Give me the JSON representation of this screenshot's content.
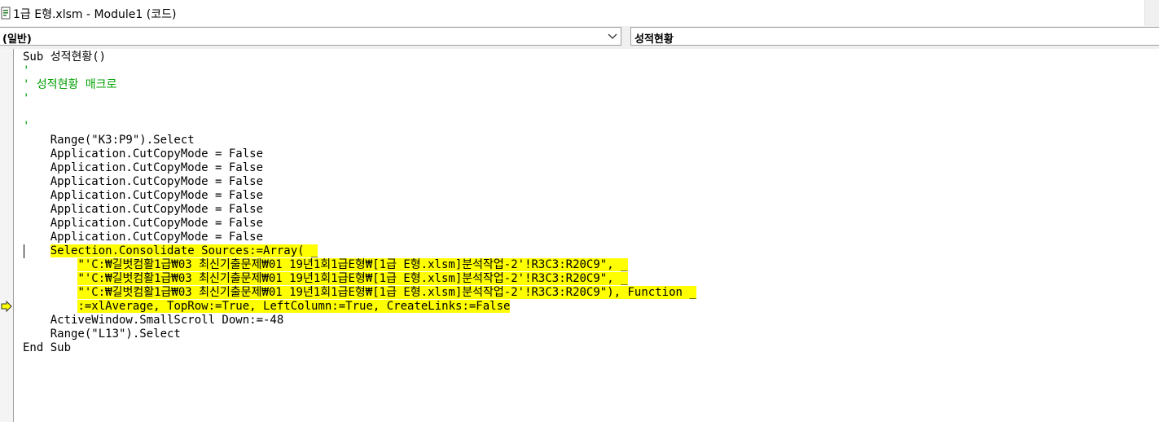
{
  "window": {
    "title": "1급 E형.xlsm - Module1 (코드)"
  },
  "dropdowns": {
    "object_value": "(일반)",
    "procedure_value": "성적현황"
  },
  "code": {
    "lines": [
      {
        "text": "Sub 성적현황()",
        "kind": "code"
      },
      {
        "text": "'",
        "kind": "comment"
      },
      {
        "text": "' 성적현황 매크로",
        "kind": "comment"
      },
      {
        "text": "'",
        "kind": "comment"
      },
      {
        "text": "",
        "kind": "code"
      },
      {
        "text": "'",
        "kind": "comment"
      },
      {
        "text": "    Range(\"K3:P9\").Select",
        "kind": "code"
      },
      {
        "text": "    Application.CutCopyMode = False",
        "kind": "code"
      },
      {
        "text": "    Application.CutCopyMode = False",
        "kind": "code"
      },
      {
        "text": "    Application.CutCopyMode = False",
        "kind": "code"
      },
      {
        "text": "    Application.CutCopyMode = False",
        "kind": "code"
      },
      {
        "text": "    Application.CutCopyMode = False",
        "kind": "code"
      },
      {
        "text": "    Application.CutCopyMode = False",
        "kind": "code"
      },
      {
        "text": "    Application.CutCopyMode = False",
        "kind": "code"
      },
      {
        "text": "    ",
        "hl": "Selection.Consolidate Sources:=Array( _",
        "kind": "highlight"
      },
      {
        "text": "        ",
        "hl": "\"'C:₩길벗컴활1급₩03 최신기출문제₩01 19년1회1급E형₩[1급 E형.xlsm]분석작업-2'!R3C3:R20C9\", _",
        "kind": "highlight"
      },
      {
        "text": "        ",
        "hl": "\"'C:₩길벗컴활1급₩03 최신기출문제₩01 19년1회1급E형₩[1급 E형.xlsm]분석작업-2'!R3C3:R20C9\", _",
        "kind": "highlight"
      },
      {
        "text": "        ",
        "hl": "\"'C:₩길벗컴활1급₩03 최신기출문제₩01 19년1회1급E형₩[1급 E형.xlsm]분석작업-2'!R3C3:R20C9\"), Function _",
        "kind": "highlight"
      },
      {
        "text": "        ",
        "hl": ":=xlAverage, TopRow:=True, LeftColumn:=True, CreateLinks:=False",
        "kind": "highlight"
      },
      {
        "text": "    ActiveWindow.SmallScroll Down:=-48",
        "kind": "code"
      },
      {
        "text": "    Range(\"L13\").Select",
        "kind": "code"
      },
      {
        "text": "End Sub",
        "kind": "code"
      }
    ]
  },
  "colors": {
    "comment": "#00a000",
    "highlight": "#ffff00",
    "execution_arrow": "#ffff00"
  },
  "icons": {
    "app": "vba-module-icon",
    "dropdown": "chevron-down-icon",
    "execution": "execution-point-arrow-icon"
  }
}
